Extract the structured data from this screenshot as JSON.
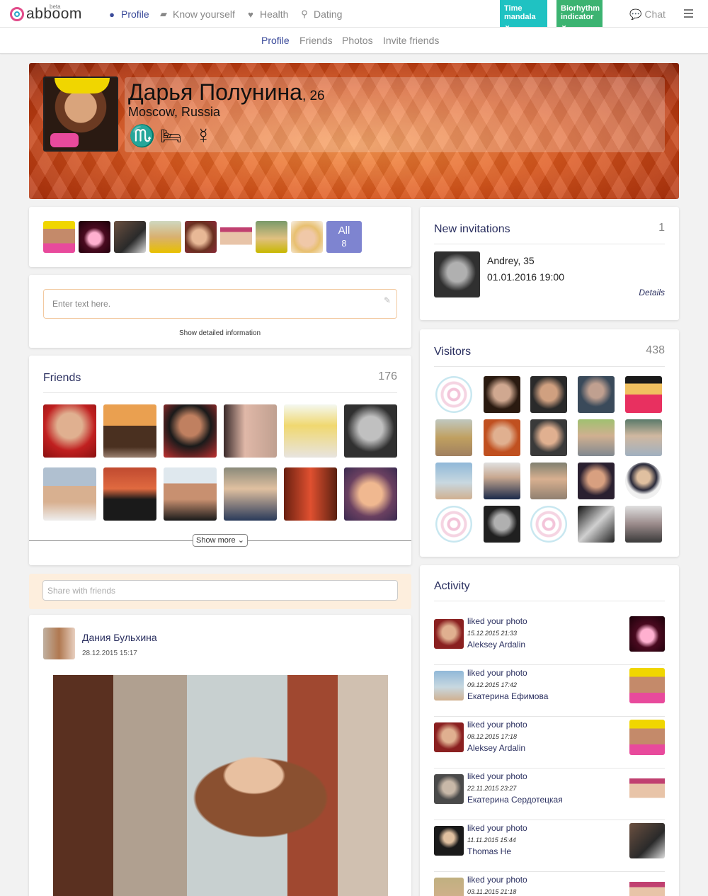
{
  "brand": {
    "name": "abboom",
    "badge": "beta"
  },
  "nav": [
    {
      "label": "Profile",
      "icon": "user-icon",
      "active": true
    },
    {
      "label": "Know yourself",
      "icon": "book-icon",
      "active": false
    },
    {
      "label": "Health",
      "icon": "heart-icon",
      "active": false
    },
    {
      "label": "Dating",
      "icon": "search-icon",
      "active": false
    }
  ],
  "top_buttons": [
    {
      "line1": "Time",
      "line2": "mandala",
      "color": "#1fc2c2"
    },
    {
      "line1": "Biorhythm",
      "line2": "indicator",
      "color": "#3cb371"
    }
  ],
  "chat_label": "Chat",
  "subnav": [
    {
      "label": "Profile",
      "active": true
    },
    {
      "label": "Friends",
      "active": false
    },
    {
      "label": "Photos",
      "active": false
    },
    {
      "label": "Invite friends",
      "active": false
    }
  ],
  "profile": {
    "name": "Дарья Полунина",
    "age": ", 26",
    "location": "Moscow, Russia",
    "signs": [
      "♏",
      "🛏",
      "☿"
    ]
  },
  "photos": {
    "all_label": "All",
    "all_count": "8"
  },
  "status": {
    "placeholder": "Enter text here.",
    "details_link": "Show detailed information"
  },
  "friends": {
    "title": "Friends",
    "count": "176",
    "show_more": "Show more ⌄"
  },
  "share": {
    "placeholder": "Share with friends"
  },
  "post": {
    "author": "Дания Бульхина",
    "date": "28.12.2015 15:17"
  },
  "invitations": {
    "title": "New invitations",
    "count": "1",
    "name": "Andrey, 35",
    "date": "01.01.2016 19:00",
    "details": "Details"
  },
  "visitors": {
    "title": "Visitors",
    "count": "438"
  },
  "activity": {
    "title": "Activity",
    "items": [
      {
        "action": "liked your photo",
        "date": "15.12.2015 21:33",
        "user": "Aleksey Ardalin"
      },
      {
        "action": "liked your photo",
        "date": "09.12.2015 17:42",
        "user": "Екатерина Ефимова"
      },
      {
        "action": "liked your photo",
        "date": "08.12.2015 17:18",
        "user": "Aleksey Ardalin"
      },
      {
        "action": "liked your photo",
        "date": "22.11.2015 23:27",
        "user": "Екатерина Сердотецкая"
      },
      {
        "action": "liked your photo",
        "date": "11.11.2015 15:44",
        "user": "Thomas He"
      },
      {
        "action": "liked your photo",
        "date": "03.11.2015 21:18",
        "user": ""
      }
    ]
  },
  "colors": {
    "accent": "#3a4a9a",
    "banner": "#e0591d",
    "all_button": "#7e84d0"
  }
}
